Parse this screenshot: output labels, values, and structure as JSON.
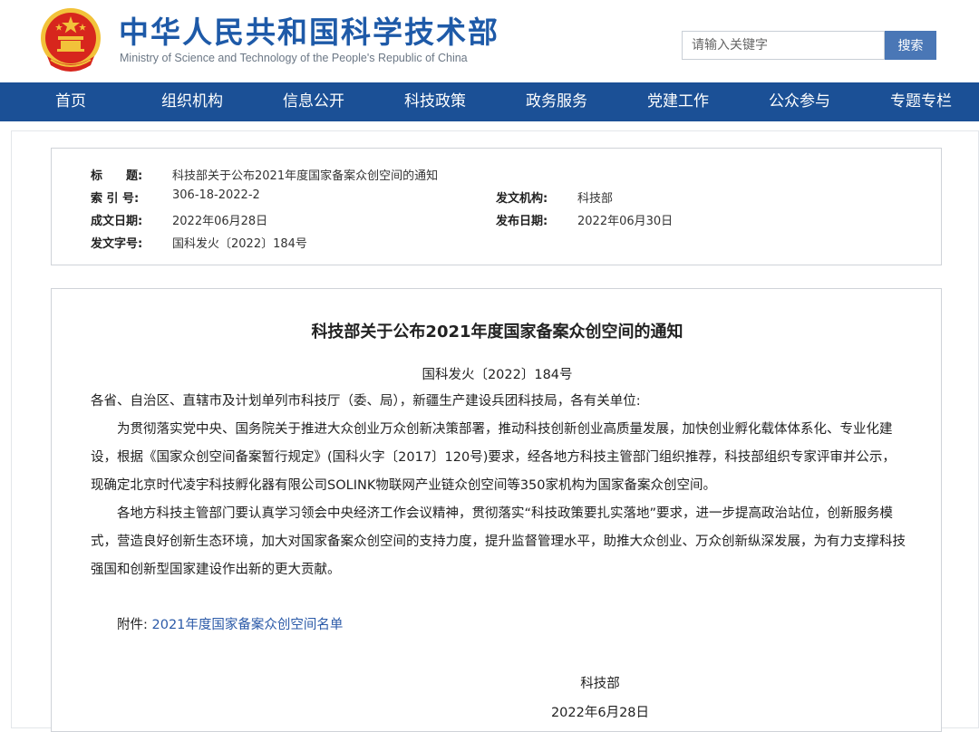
{
  "header": {
    "title_cn": "中华人民共和国科学技术部",
    "title_en": "Ministry of Science and Technology of the People's Republic of China",
    "search_placeholder": "请输入关键字",
    "search_button": "搜索"
  },
  "nav": {
    "items": [
      "首页",
      "组织机构",
      "信息公开",
      "科技政策",
      "政务服务",
      "党建工作",
      "公众参与",
      "专题专栏"
    ]
  },
  "meta": {
    "title_label": "标　　题:",
    "title_value": "科技部关于公布2021年度国家备案众创空间的通知",
    "index_label": "索 引 号:",
    "index_value": "306-18-2022-2",
    "issuer_label": "发文机构:",
    "issuer_value": "科技部",
    "created_label": "成文日期:",
    "created_value": "2022年06月28日",
    "published_label": "发布日期:",
    "published_value": "2022年06月30日",
    "docno_label": "发文字号:",
    "docno_value": "国科发火〔2022〕184号"
  },
  "article": {
    "title": "科技部关于公布2021年度国家备案众创空间的通知",
    "doc_number": "国科发火〔2022〕184号",
    "salutation": "各省、自治区、直辖市及计划单列市科技厅（委、局），新疆生产建设兵团科技局，各有关单位:",
    "paragraph1": "为贯彻落实党中央、国务院关于推进大众创业万众创新决策部署，推动科技创新创业高质量发展，加快创业孵化载体体系化、专业化建设，根据《国家众创空间备案暂行规定》(国科火字〔2017〕120号)要求，经各地方科技主管部门组织推荐，科技部组织专家评审并公示，现确定北京时代凌宇科技孵化器有限公司SOLINK物联网产业链众创空间等350家机构为国家备案众创空间。",
    "paragraph2": "各地方科技主管部门要认真学习领会中央经济工作会议精神，贯彻落实“科技政策要扎实落地”要求，进一步提高政治站位，创新服务模式，营造良好创新生态环境，加大对国家备案众创空间的支持力度，提升监督管理水平，助推大众创业、万众创新纵深发展，为有力支撑科技强国和创新型国家建设作出新的更大贡献。",
    "attachment_label": "附件:",
    "attachment_link": "2021年度国家备案众创空间名单",
    "signature": "科技部",
    "date": "2022年6月28日"
  },
  "colors": {
    "brand_blue": "#1e5aa8",
    "nav_blue": "#1b5096",
    "emblem_red": "#d7261d",
    "emblem_gold": "#f2c23a"
  }
}
